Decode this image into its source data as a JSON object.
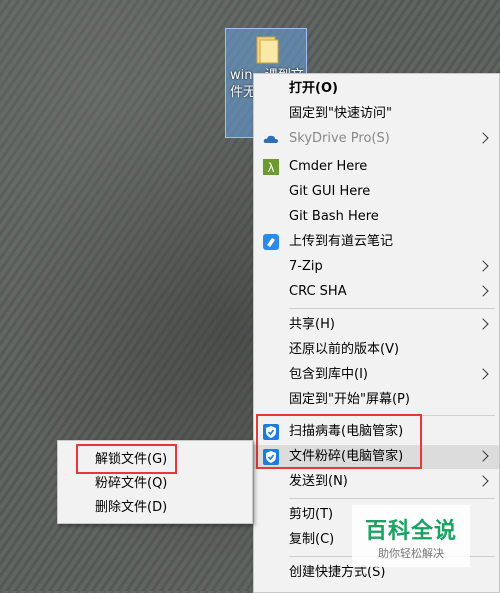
{
  "desktop": {
    "icon_label": "win...课到文件无法动"
  },
  "menu": {
    "items": [
      {
        "label": "打开(O)"
      },
      {
        "label": "固定到\"快速访问\""
      },
      {
        "label": "SkyDrive Pro(S)"
      },
      {
        "label": "Cmder Here"
      },
      {
        "label": "Git GUI Here"
      },
      {
        "label": "Git Bash Here"
      },
      {
        "label": "上传到有道云笔记"
      },
      {
        "label": "7-Zip"
      },
      {
        "label": "CRC SHA"
      },
      {
        "label": "共享(H)"
      },
      {
        "label": "还原以前的版本(V)"
      },
      {
        "label": "包含到库中(I)"
      },
      {
        "label": "固定到\"开始\"屏幕(P)"
      },
      {
        "label": "扫描病毒(电脑管家)"
      },
      {
        "label": "文件粉碎(电脑管家)"
      },
      {
        "label": "发送到(N)"
      },
      {
        "label": "剪切(T)"
      },
      {
        "label": "复制(C)"
      },
      {
        "label": "创建快捷方式(S)"
      }
    ]
  },
  "submenu": {
    "items": [
      {
        "label": "解锁文件(G)"
      },
      {
        "label": "粉碎文件(Q)"
      },
      {
        "label": "删除文件(D)"
      }
    ]
  },
  "watermark": {
    "title": "百科全说",
    "subtitle": "助你轻松解决"
  },
  "colors": {
    "highlight_box": "#e53935",
    "menu_bg": "#f2f2f2",
    "watermark_green": "#1aa260"
  }
}
